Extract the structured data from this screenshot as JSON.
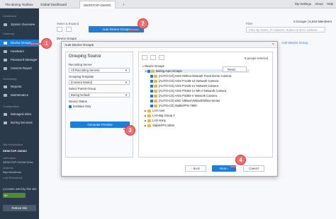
{
  "tabs": [
    "The Boring Toolbox",
    "Global Dashboard",
    "DESKTOP-O6O6C"
  ],
  "new_tab": "+",
  "topbar": {
    "settings": "My Settings",
    "about": "About",
    "help": "Help"
  },
  "sidebar": {
    "dashboard_section": "Dashboard",
    "system_overview": "System Overview",
    "cameras_section": "Cameras",
    "items": [
      "Device Groups",
      "Hardware",
      "Password Manager",
      "Camera Report"
    ],
    "scheduling_section": "Scheduling",
    "scheduling_items": [
      "Reports",
      "Maintenance"
    ],
    "config_section": "Configuration",
    "config_items": [
      "Managed Sites",
      "Boring Services"
    ],
    "site_info_label": "Site Information",
    "site_name": "DESKTOP-O6O6C",
    "username_label": "Username",
    "username_value": "DESKTOP-O6O6C\\Elev",
    "address_label": "Address",
    "address_value": "http://localhost",
    "last_refreshed_label": "Last Refreshed",
    "licenses_label": "Licenses used by this site",
    "licenses_value": "80",
    "reboot_label": "Reboot Site"
  },
  "main": {
    "select_expand": "Select & Expand",
    "auto_groups_btn": "Auto Device Groups",
    "filter_label": "Filter",
    "filter_placeholder": "Filter By Name, IP Address, Subnet & MAC Address",
    "count": "4 Groups | 8,916 Members",
    "tree_root": "Device Groups",
    "add_group": "Add Device Group"
  },
  "dialog": {
    "title": "Auto Device Groups",
    "close": "×",
    "grouping_source": "Grouping Source",
    "recording_server_label": "Recording Server",
    "recording_server_value": "All Recording Servers",
    "grouping_template_label": "Grouping Template",
    "grouping_template_value": "[Camera Model]",
    "parent_group_label": "Select Parent Group",
    "parent_group_value": "Boring Default",
    "device_status_label": "Device Status",
    "enabled_only": "Enabled Only",
    "generate_btn": "Generate Preview",
    "groups_selected": "8 groups selected",
    "reset_btn": "Reset",
    "tree": [
      "Device Groups",
      "Boring Auto Groups",
      "[AUTO-CO] AXIS M3014 Network Fixed Dome Camera",
      "[AUTO-CO] AXIS P1435-LE Network Camera",
      "[AUTO-CO] AXIS P1425-LV Network Camera",
      "[AUTO-CO] AXIS P3364-LV MK-II Network Camera",
      "[AUTO-CO] AXIS P3384-V Network Camera",
      "[AUTO-CO] SNC-VB6xx/VM6xx/EM6xx-Series",
      "[AUTO-CO] StableFPS-T600",
      "LAX-Axis",
      "LAX-Big Group 2",
      "LAX-Sony",
      "StableFPS NEW"
    ],
    "back": "Back",
    "next": "Next",
    "cancel": "Cancel"
  },
  "markers": [
    "1",
    "2",
    "3",
    "4"
  ]
}
